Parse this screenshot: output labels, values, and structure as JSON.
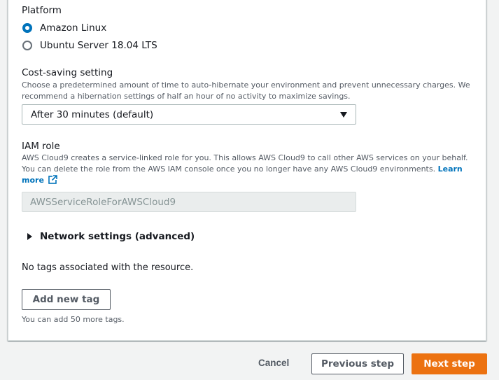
{
  "platform": {
    "label": "Platform",
    "options": [
      {
        "label": "Amazon Linux",
        "selected": true
      },
      {
        "label": "Ubuntu Server 18.04 LTS",
        "selected": false
      }
    ]
  },
  "cost_saving": {
    "label": "Cost-saving setting",
    "description_line1": "Choose a predetermined amount of time to auto-hibernate your environment and prevent unnecessary charges. We",
    "description_line2": "recommend a hibernation settings of half an hour of no activity to maximize savings.",
    "selected_value": "After 30 minutes (default)"
  },
  "iam_role": {
    "label": "IAM role",
    "description_line1": "AWS Cloud9 creates a service-linked role for you. This allows AWS Cloud9 to call other AWS services on your behalf.",
    "description_line2": "You can delete the role from the AWS IAM console once you no longer have any AWS Cloud9 environments.",
    "learn_more_part1": "Learn",
    "learn_more_part2": "more",
    "value": "AWSServiceRoleForAWSCloud9"
  },
  "network": {
    "label": "Network settings (advanced)"
  },
  "tags": {
    "empty_text": "No tags associated with the resource.",
    "add_button": "Add new tag",
    "hint": "You can add 50 more tags."
  },
  "footer": {
    "cancel": "Cancel",
    "previous": "Previous step",
    "next": "Next step"
  },
  "colors": {
    "accent": "#0073bb",
    "primary_button": "#ec7211"
  },
  "icons": {
    "external_link": "external-link-icon",
    "expand": "caret-right-icon",
    "dropdown": "caret-down-icon"
  }
}
